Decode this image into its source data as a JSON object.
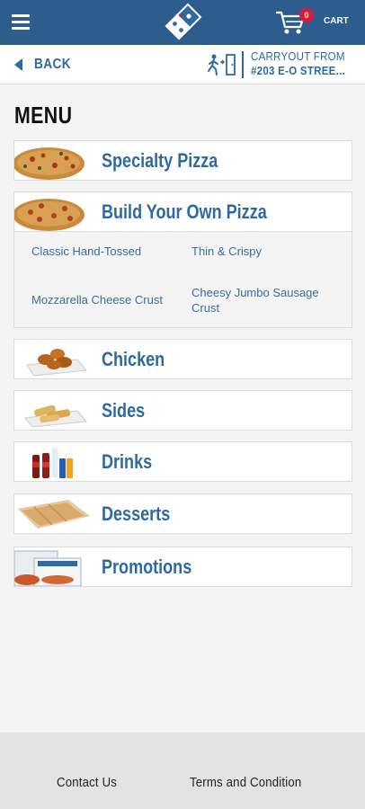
{
  "header": {
    "menu_icon": "hamburger-icon",
    "logo_icon": "dominos-domino-logo",
    "cart_icon": "cart-icon",
    "cart_count": "0",
    "cart_label": "CART",
    "colors": {
      "bar": "#2c5d8c",
      "badge": "#e31837"
    }
  },
  "subheader": {
    "back_label": "BACK",
    "carryout_icon": "walk-to-door-icon",
    "carryout_line1": "CARRYOUT FROM",
    "carryout_line2": "#203 E-O STREE..."
  },
  "menu": {
    "title": "MENU",
    "categories": [
      {
        "label": "Specialty Pizza",
        "icon": "pizza-photo"
      },
      {
        "label": "Build Your Own Pizza",
        "icon": "pizza-photo"
      },
      {
        "label": "Chicken",
        "icon": "chicken-wings-photo"
      },
      {
        "label": "Sides",
        "icon": "bread-twists-photo"
      },
      {
        "label": "Drinks",
        "icon": "soda-bottles-photo"
      },
      {
        "label": "Desserts",
        "icon": "dessert-bread-photo"
      },
      {
        "label": "Promotions",
        "icon": "promo-pizza-box-photo"
      }
    ],
    "build_your_own_options": [
      "Classic Hand-Tossed",
      "Thin & Crispy",
      "Mozzarella Cheese Crust",
      "Cheesy Jumbo Sausage Crust"
    ],
    "accent_color": "#2c6aa0"
  },
  "footer": {
    "contact_label": "Contact Us",
    "terms_label": "Terms and Condition"
  }
}
